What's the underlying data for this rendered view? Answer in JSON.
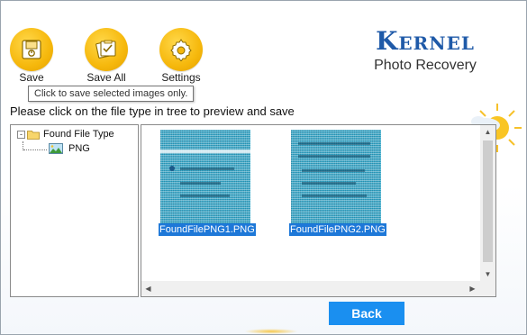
{
  "toolbar": {
    "items": [
      {
        "label": "Save",
        "icon": "save-icon"
      },
      {
        "label": "Save All",
        "icon": "save-all-icon"
      },
      {
        "label": "Settings",
        "icon": "gear-icon"
      }
    ],
    "tooltip": "Click to save selected images only."
  },
  "brand": {
    "name": "Kernel",
    "product": "Photo Recovery"
  },
  "instruction": "Please click on the file type in tree to preview and save",
  "tree": {
    "root": {
      "label": "Found File Type",
      "expander": "-",
      "icon": "folder-icon"
    },
    "children": [
      {
        "label": "PNG",
        "icon": "image-icon"
      }
    ]
  },
  "preview": {
    "files": [
      {
        "name": "FoundFilePNG1.PNG",
        "selected": true
      },
      {
        "name": "FoundFilePNG2.PNG",
        "selected": true
      }
    ]
  },
  "footer": {
    "back_label": "Back"
  },
  "colors": {
    "accent": "#1a8ff0",
    "selection": "#1e78d8",
    "toolbar_icon": "#f6b80c",
    "brand": "#1f5aa8"
  }
}
